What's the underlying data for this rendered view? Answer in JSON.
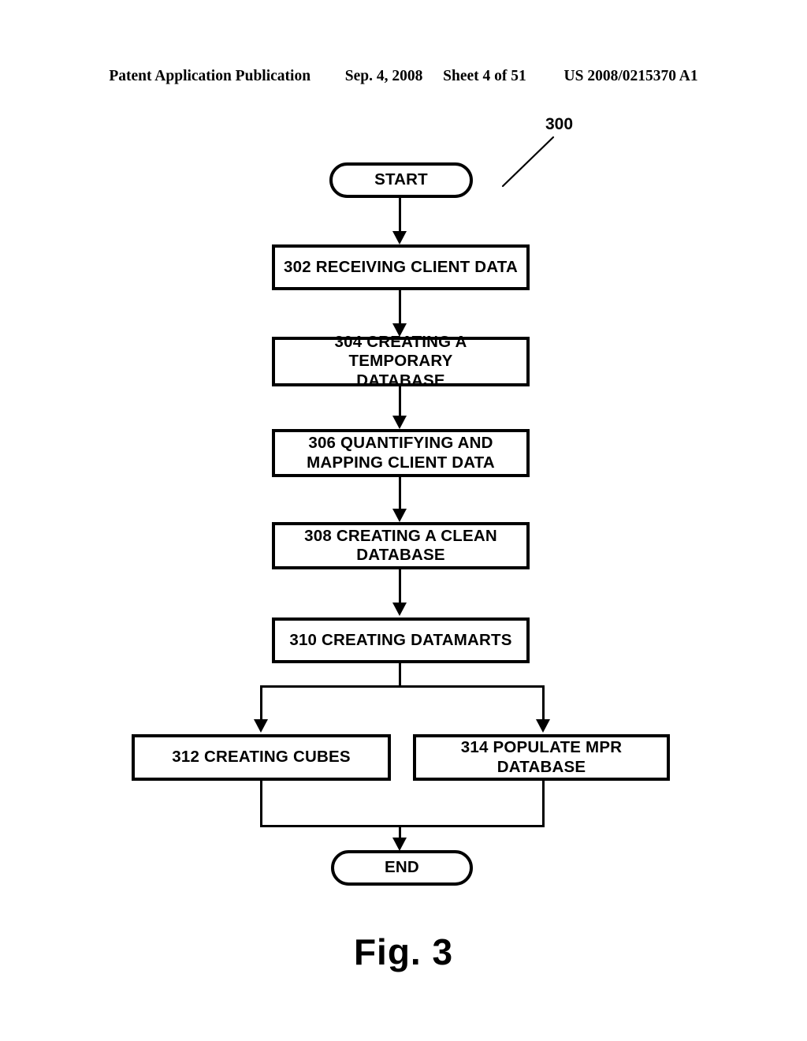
{
  "header": {
    "publication": "Patent Application Publication",
    "date": "Sep. 4, 2008",
    "sheet": "Sheet 4 of 51",
    "patent_number": "US 2008/0215370 A1"
  },
  "figure": {
    "reference_numeral": "300",
    "caption": "Fig. 3",
    "type": "flowchart"
  },
  "flowchart": {
    "nodes": [
      {
        "id": "start",
        "shape": "terminal",
        "label": "START"
      },
      {
        "id": "302",
        "shape": "process",
        "label": "302 RECEIVING CLIENT DATA"
      },
      {
        "id": "304",
        "shape": "process",
        "line1": "304 CREATING A TEMPORARY",
        "line2": "DATABASE"
      },
      {
        "id": "306",
        "shape": "process",
        "line1": "306 QUANTIFYING AND",
        "line2": "MAPPING CLIENT DATA"
      },
      {
        "id": "308",
        "shape": "process",
        "line1": "308 CREATING A CLEAN",
        "line2": "DATABASE"
      },
      {
        "id": "310",
        "shape": "process",
        "label": "310 CREATING DATAMARTS"
      },
      {
        "id": "312",
        "shape": "process",
        "label": "312 CREATING CUBES"
      },
      {
        "id": "314",
        "shape": "process",
        "label": "314 POPULATE MPR DATABASE"
      },
      {
        "id": "end",
        "shape": "terminal",
        "label": "END"
      }
    ],
    "colors": {
      "stroke": "#000000",
      "fill": "#ffffff",
      "text": "#000000"
    }
  }
}
